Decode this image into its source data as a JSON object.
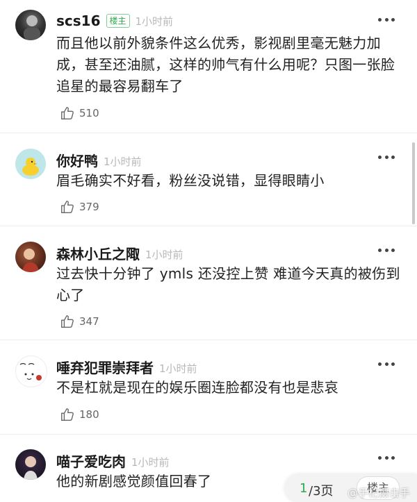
{
  "comments": [
    {
      "username": "scs16",
      "badge": "楼主",
      "time": "1小时前",
      "text": "而且他以前外貌条件这么优秀，影视剧里毫无魅力加成，甚至还油腻，这样的帅气有什么用呢？只图一张脸追星的最容易翻车了",
      "likes": "510"
    },
    {
      "username": "你好鸭",
      "time": "1小时前",
      "text": "眉毛确实不好看，粉丝没说错，显得眼睛小",
      "likes": "379"
    },
    {
      "username": "森林小丘之陬",
      "time": "1小时前",
      "text": "过去快十分钟了 ymls 还没控上赞 难道今天真的被伤到心了",
      "likes": "347"
    },
    {
      "username": "唾弃犯罪崇拜者",
      "time": "1小时前",
      "text": "不是杠就是现在的娱乐圈连脸都没有也是悲哀",
      "likes": "180"
    },
    {
      "username": "喵子爱吃肉",
      "time": "1小时前",
      "text": "他的新剧感觉颜值回春了"
    }
  ],
  "pager": {
    "current": "1",
    "total": "/3页",
    "host_button": "楼主"
  },
  "watermark": "@手杞摄击手",
  "icons": {
    "like": "thumbs-up-icon",
    "more": "more-dots-icon"
  },
  "colors": {
    "accent_green": "#2fa84f",
    "muted_text": "#b8b8b8"
  }
}
